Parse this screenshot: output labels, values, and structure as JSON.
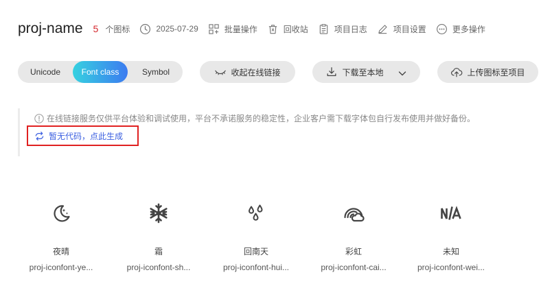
{
  "header": {
    "project_name": "proj-name",
    "icon_count": "5",
    "icon_count_label": "个图标",
    "date": "2025-07-29",
    "batch_ops": "批量操作",
    "recycle_bin": "回收站",
    "project_log": "项目日志",
    "project_settings": "项目设置",
    "more_ops": "更多操作"
  },
  "toolbar": {
    "tabs": [
      "Unicode",
      "Font class",
      "Symbol"
    ],
    "active_tab": "Font class",
    "collapse_link": "收起在线链接",
    "download_local": "下载至本地",
    "upload_icons": "上传图标至项目"
  },
  "notice": {
    "text": "在线链接服务仅供平台体验和调试使用，平台不承诺服务的稳定性，企业客户需下载字体包自行发布使用并做好备份。",
    "generate_code": "暂无代码，点此生成"
  },
  "icons": [
    {
      "name": "夜晴",
      "class": "proj-iconfont-ye...",
      "icon": "moon-icon"
    },
    {
      "name": "霜",
      "class": "proj-iconfont-sh...",
      "icon": "snowflake-icon"
    },
    {
      "name": "回南天",
      "class": "proj-iconfont-hui...",
      "icon": "water-drops-icon"
    },
    {
      "name": "彩虹",
      "class": "proj-iconfont-cai...",
      "icon": "rainbow-icon"
    },
    {
      "name": "未知",
      "class": "proj-iconfont-wei...",
      "icon": "na-icon"
    }
  ],
  "colors": {
    "accent_gradient_start": "#36d1e0",
    "accent_gradient_end": "#3c7bf0",
    "link_blue": "#3b5fe0",
    "count_red": "#d4262c",
    "highlight_red": "#e02020",
    "pill_gray": "#e8e8e8"
  }
}
